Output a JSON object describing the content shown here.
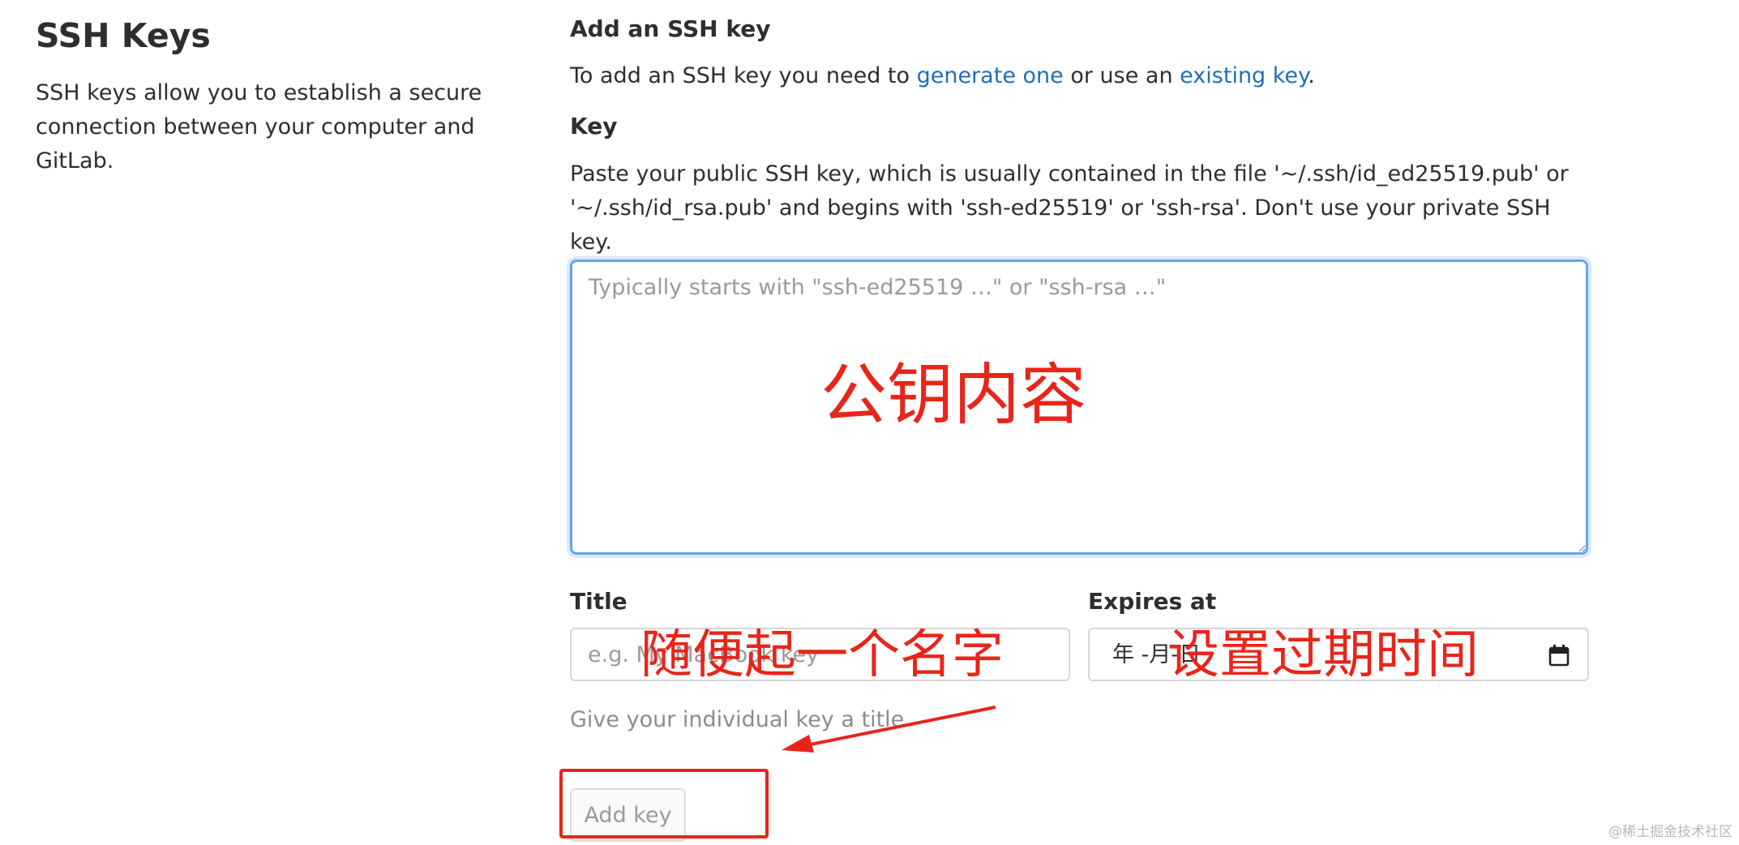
{
  "left": {
    "title": "SSH Keys",
    "description": "SSH keys allow you to establish a secure connection between your computer and GitLab."
  },
  "form": {
    "heading": "Add an SSH key",
    "intro_prefix": "To add an SSH key you need to ",
    "intro_link1": "generate one",
    "intro_middle": " or use an ",
    "intro_link2": "existing key",
    "intro_suffix": ".",
    "key_label": "Key",
    "key_help": "Paste your public SSH key, which is usually contained in the file '~/.ssh/id_ed25519.pub' or '~/.ssh/id_rsa.pub' and begins with 'ssh-ed25519' or 'ssh-rsa'. Don't use your private SSH key.",
    "key_placeholder": "Typically starts with \"ssh-ed25519 …\" or \"ssh-rsa …\"",
    "key_value": "",
    "title_label": "Title",
    "title_placeholder": "e.g. My MacBook key",
    "title_value": "",
    "title_hint": "Give your individual key a title",
    "expires_label": "Expires at",
    "expires_value": "年 -月-日",
    "calendar_icon": "calendar-icon",
    "add_button": "Add key"
  },
  "annotations": {
    "key_note": "公钥内容",
    "title_note": "随便起一个名字",
    "expires_note": "设置过期时间",
    "color": "#e8251a"
  },
  "colors": {
    "link": "#1f6fb5",
    "focus_border": "#63a6e9",
    "annotation_red": "#e8251a"
  },
  "watermark": "@稀土掘金技术社区"
}
